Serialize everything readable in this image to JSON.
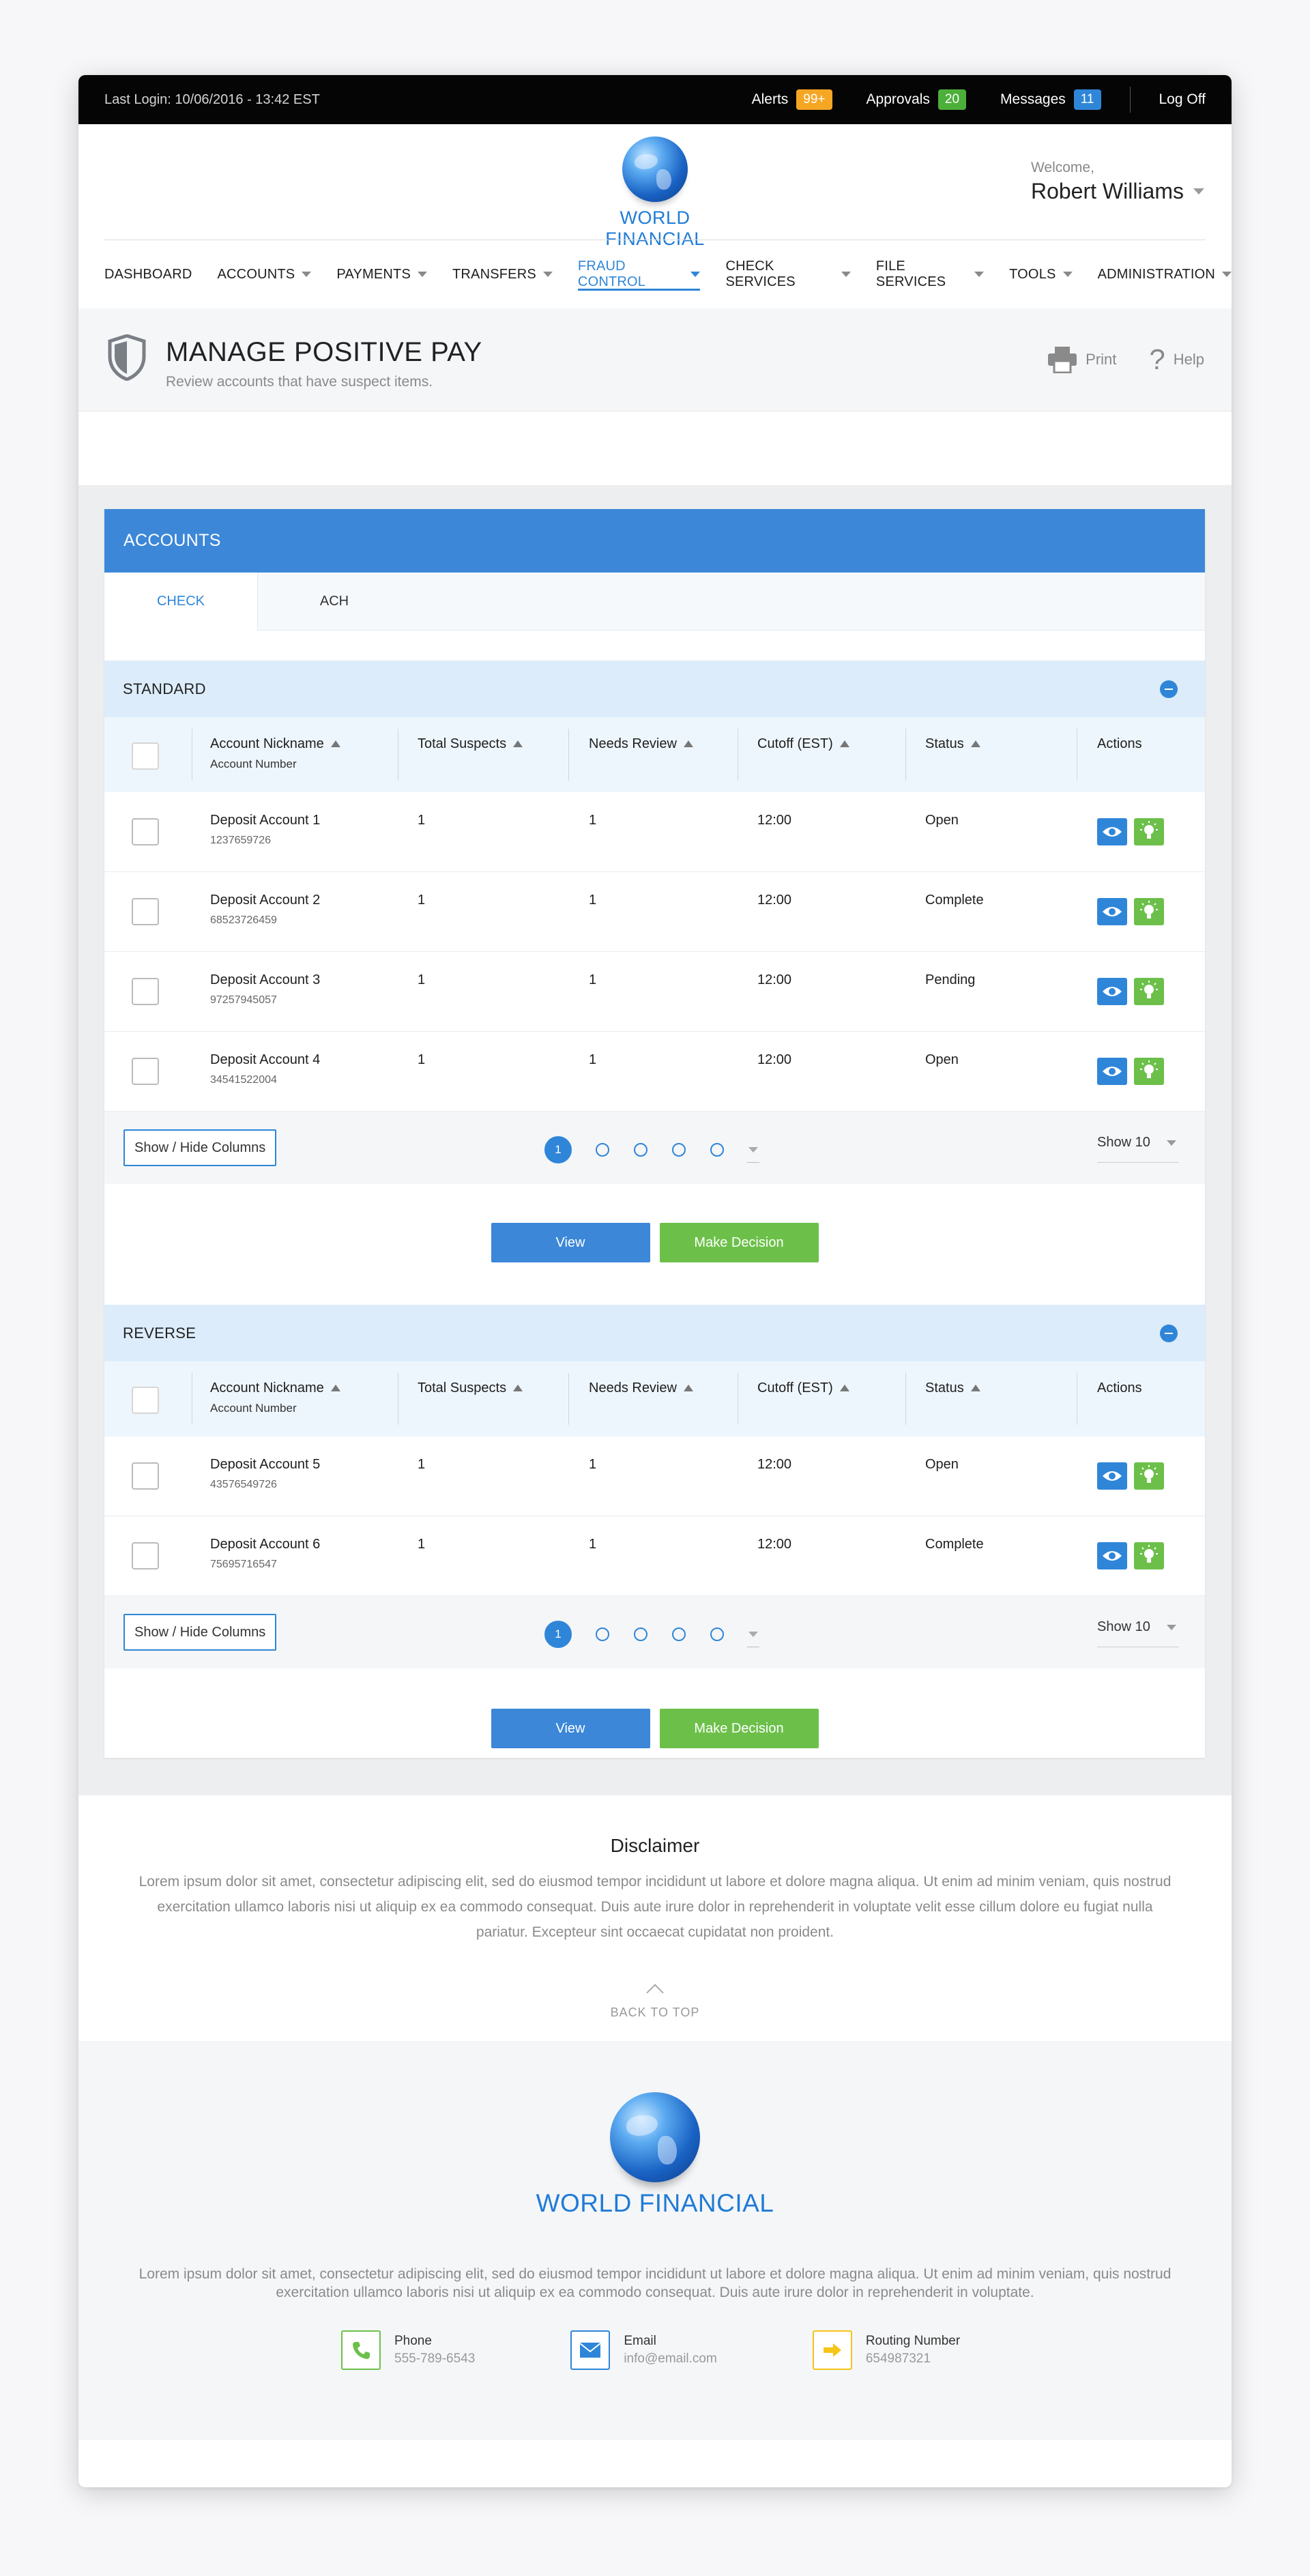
{
  "topbar": {
    "last_login": "Last Login: 10/06/2016 - 13:42 EST",
    "alerts_label": "Alerts",
    "alerts_count": "99+",
    "approvals_label": "Approvals",
    "approvals_count": "20",
    "messages_label": "Messages",
    "messages_count": "11",
    "logoff": "Log Off"
  },
  "brand": {
    "name": "WORLD FINANCIAL"
  },
  "user": {
    "welcome": "Welcome,",
    "name": "Robert Williams"
  },
  "nav": {
    "items": [
      {
        "label": "DASHBOARD"
      },
      {
        "label": "ACCOUNTS"
      },
      {
        "label": "PAYMENTS"
      },
      {
        "label": "TRANSFERS"
      },
      {
        "label": "FRAUD CONTROL"
      },
      {
        "label": "CHECK SERVICES"
      },
      {
        "label": "FILE SERVICES"
      },
      {
        "label": "TOOLS"
      },
      {
        "label": "ADMINISTRATION"
      }
    ]
  },
  "page": {
    "title": "MANAGE POSITIVE PAY",
    "subtitle": "Review accounts that have suspect items.",
    "print": "Print",
    "help": "Help"
  },
  "accounts": {
    "header": "ACCOUNTS",
    "tabs": [
      "CHECK",
      "ACH"
    ]
  },
  "table_headers": {
    "nickname": "Account Nickname",
    "account_number": "Account Number",
    "suspects": "Total Suspects",
    "review": "Needs Review",
    "cutoff": "Cutoff (EST)",
    "status": "Status",
    "actions": "Actions"
  },
  "standard": {
    "title": "STANDARD",
    "rows": [
      {
        "name": "Deposit Account 1",
        "number": "1237659726",
        "suspects": "1",
        "review": "1",
        "cutoff": "12:00",
        "status": "Open"
      },
      {
        "name": "Deposit Account 2",
        "number": "68523726459",
        "suspects": "1",
        "review": "1",
        "cutoff": "12:00",
        "status": "Complete"
      },
      {
        "name": "Deposit Account 3",
        "number": "97257945057",
        "suspects": "1",
        "review": "1",
        "cutoff": "12:00",
        "status": "Pending"
      },
      {
        "name": "Deposit Account 4",
        "number": "34541522004",
        "suspects": "1",
        "review": "1",
        "cutoff": "12:00",
        "status": "Open"
      }
    ]
  },
  "reverse": {
    "title": "REVERSE",
    "rows": [
      {
        "name": "Deposit Account 5",
        "number": "43576549726",
        "suspects": "1",
        "review": "1",
        "cutoff": "12:00",
        "status": "Open"
      },
      {
        "name": "Deposit Account 6",
        "number": "75695716547",
        "suspects": "1",
        "review": "1",
        "cutoff": "12:00",
        "status": "Complete"
      }
    ]
  },
  "controls": {
    "show_hide": "Show / Hide Columns",
    "current_page": "1",
    "show": "Show 10",
    "view": "View",
    "decision": "Make Decision"
  },
  "disclaimer": {
    "title": "Disclaimer",
    "text": "Lorem ipsum dolor sit amet, consectetur adipiscing elit, sed do eiusmod tempor incididunt ut labore et dolore magna aliqua. Ut enim ad minim veniam, quis nostrud exercitation ullamco laboris nisi ut aliquip ex ea commodo consequat. Duis aute irure dolor in reprehenderit in voluptate velit esse cillum dolore eu fugiat nulla pariatur. Excepteur sint occaecat cupidatat non proident.",
    "back_to_top": "BACK TO TOP"
  },
  "footer": {
    "text": "Lorem ipsum dolor sit amet, consectetur adipiscing elit, sed do eiusmod tempor incididunt ut labore et dolore magna aliqua. Ut enim ad minim veniam, quis nostrud exercitation ullamco laboris nisi ut aliquip ex ea commodo consequat. Duis aute irure dolor in reprehenderit in voluptate.",
    "phone_label": "Phone",
    "phone": "555-789-6543",
    "email_label": "Email",
    "email": "info@email.com",
    "routing_label": "Routing Number",
    "routing": "654987321"
  },
  "colors": {
    "accent": "#2f86d8",
    "success": "#6cc04a",
    "warning": "#f5a623",
    "topbar": "#050505"
  },
  "icons": [
    "shield-icon",
    "printer-icon",
    "help-icon",
    "eye-icon",
    "lightbulb-icon",
    "phone-icon",
    "envelope-icon",
    "arrow-right-icon",
    "globe-logo"
  ]
}
